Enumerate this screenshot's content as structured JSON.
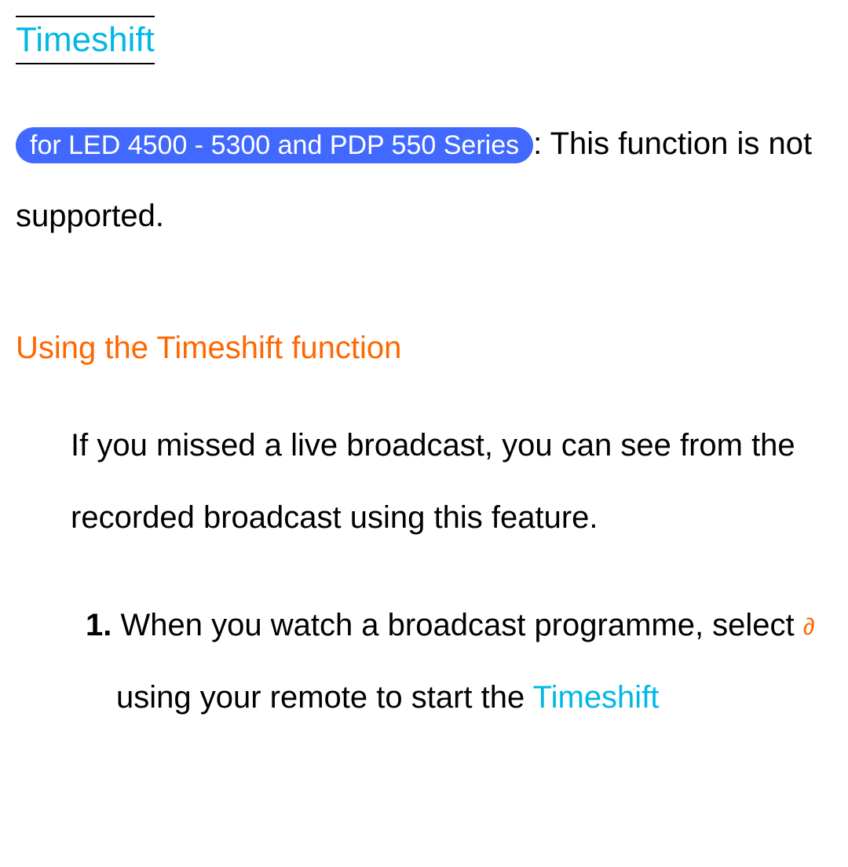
{
  "title": "Timeshift",
  "note": {
    "badge": "for LED 4500 - 5300 and PDP 550 Series",
    "text_after_badge": ": This function is not supported."
  },
  "section_heading": "Using the Timeshift function",
  "body_text": "If you missed a live broadcast, you can see from the recorded broadcast using this feature.",
  "list": {
    "number": "1.",
    "part1": "When you watch a broadcast programme, select ",
    "play_symbol": "∂",
    "part2": " using your remote to start the ",
    "keyword": "Timeshift"
  }
}
